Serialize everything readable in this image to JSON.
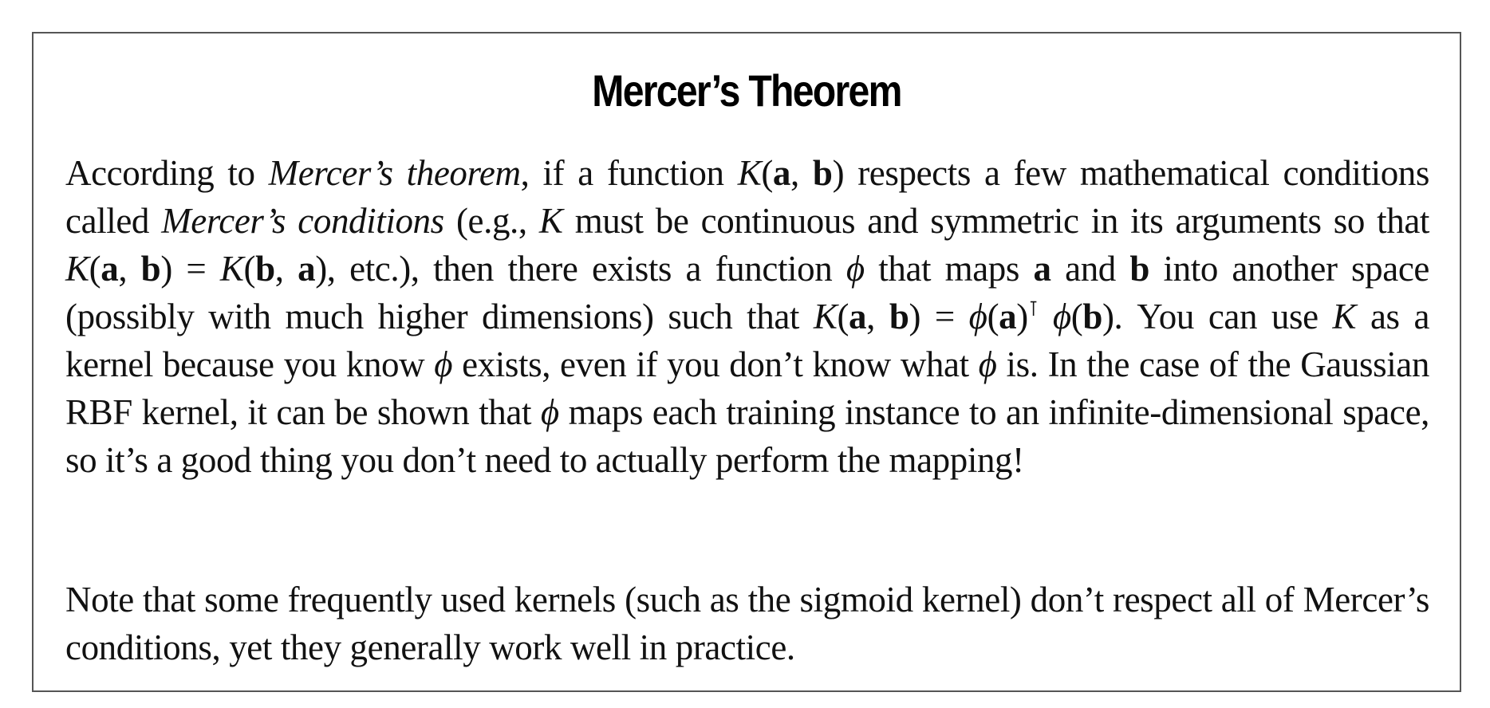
{
  "sidebar": {
    "title": "Mercer’s Theorem",
    "paragraph1": {
      "t01": "According to ",
      "t02": "Mercer’s theorem",
      "t03": ", if a function ",
      "t04": "K",
      "t05": "(",
      "t06": "a",
      "t07": ", ",
      "t08": "b",
      "t09": ") respects a few mathematical conditions called ",
      "t10": "Mercer’s conditions",
      "t11": " (e.g., ",
      "t12": "K",
      "t13": " must be continuous and symmetric in its arguments so that ",
      "t14": "K",
      "t15": "(",
      "t16": "a",
      "t17": ", ",
      "t18": "b",
      "t19": ") = ",
      "t20": "K",
      "t21": "(",
      "t22": "b",
      "t23": ", ",
      "t24": "a",
      "t25": "), etc.), then there exists a function ",
      "t26": "ϕ",
      "t27": " that maps ",
      "t28": "a",
      "t29": " and ",
      "t30": "b",
      "t31": " into another space (possibly with much higher dimensions) such that ",
      "t32": "K",
      "t33": "(",
      "t34": "a",
      "t35": ", ",
      "t36": "b",
      "t37": ") = ",
      "t38": "ϕ",
      "t39": "(",
      "t40": "a",
      "t41": ")",
      "t42": "⊺",
      "t43": " ",
      "t44": "ϕ",
      "t45": "(",
      "t46": "b",
      "t47": "). You can use ",
      "t48": "K",
      "t49": " as a kernel because you know ",
      "t50": "ϕ",
      "t51": " exists, even if you don’t know what ",
      "t52": "ϕ",
      "t53": " is. In the case of the Gaussian RBF kernel, it can be shown that ",
      "t54": "ϕ",
      "t55": " maps each training instance to an infinite-dimensional space, so it’s a good thing you don’t need to actually perform the mapping!"
    },
    "paragraph2": "Note that some frequently used kernels (such as the sigmoid kernel) don’t respect all of Mercer’s conditions, yet they generally work well in practice."
  }
}
